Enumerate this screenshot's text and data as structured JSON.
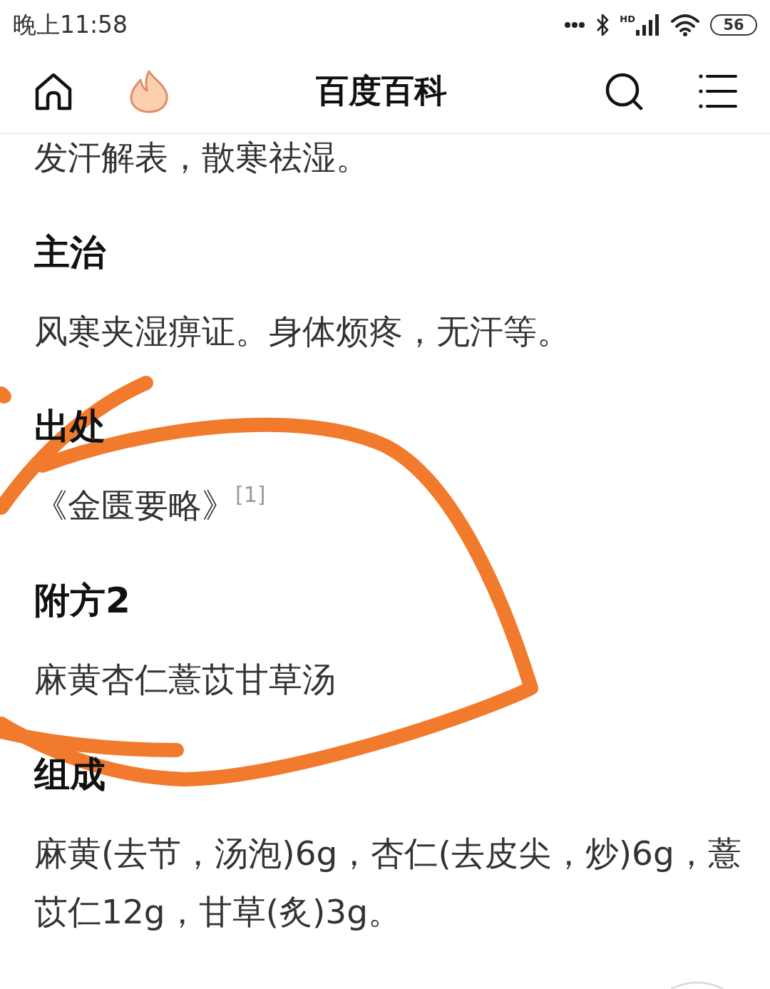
{
  "status_bar": {
    "time": "晚上11:58",
    "network_type": "HD",
    "battery": "56"
  },
  "nav_bar": {
    "title": "百度百科"
  },
  "article": {
    "blocks": [
      {
        "kind": "paragraph",
        "text": "发汗解表，散寒祛湿。"
      },
      {
        "kind": "heading",
        "text": "主治"
      },
      {
        "kind": "paragraph",
        "text": "风寒夹湿痹证。身体烦疼，无汗等。"
      },
      {
        "kind": "heading",
        "text": "出处"
      },
      {
        "kind": "paragraph",
        "text": "《金匮要略》",
        "citation": "[1]"
      },
      {
        "kind": "heading",
        "text": "附方2"
      },
      {
        "kind": "paragraph",
        "text": "麻黄杏仁薏苡甘草汤"
      },
      {
        "kind": "heading",
        "text": "组成"
      },
      {
        "kind": "paragraph",
        "text": "麻黄(去节，汤泡)6g，杏仁(去皮尖，炒)6g，薏苡仁12g，甘草(炙)3g。"
      }
    ]
  }
}
